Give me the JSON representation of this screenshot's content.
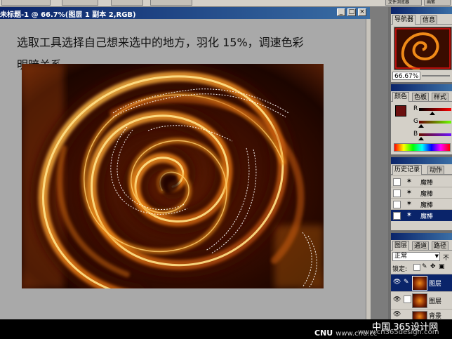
{
  "topbar": {
    "left_items": [
      "—",
      "█"
    ],
    "file_browser_label": "文件浏览器",
    "brushes_label": "画笔"
  },
  "document": {
    "title": "未标题-1 @ 66.7%(图层 1 副本 2,RGB)",
    "minimize": "_",
    "maximize": "□",
    "close": "×",
    "caption_line1": "选取工具选择自己想来选中的地方，羽化 15%，调速色彩",
    "caption_line2": "明暗关系。"
  },
  "navigator": {
    "tab_navigator": "导航器",
    "tab_info": "信息",
    "zoom_value": "66.67%"
  },
  "color": {
    "tab_color": "颜色",
    "tab_swatches": "色板",
    "tab_styles": "样式",
    "label_r": "R",
    "label_g": "G",
    "label_b": "B",
    "foreground_hex": "#6b1010",
    "background_hex": "#ffffff",
    "r_level": 0.42,
    "g_level": 0.06,
    "b_level": 0.06
  },
  "history": {
    "tab_history": "历史记录",
    "tab_actions": "动作",
    "items": [
      {
        "label": "魔棒",
        "selected": false
      },
      {
        "label": "魔棒",
        "selected": false
      },
      {
        "label": "魔棒",
        "selected": false
      },
      {
        "label": "魔棒",
        "selected": true
      }
    ]
  },
  "layers": {
    "tab_layers": "图层",
    "tab_channels": "通道",
    "tab_paths": "路径",
    "blend_mode": "正常",
    "opacity_prefix": "不",
    "lock_label": "锁定:",
    "rows": [
      {
        "label": "图层",
        "selected": true
      },
      {
        "label": "图层",
        "selected": false
      },
      {
        "label": "背景",
        "selected": false
      }
    ]
  },
  "watermark": {
    "site_cn": "中国 365设计网",
    "site_url": "www.cn365design.com",
    "cnu_logo": "CNU",
    "cnu_url": "www.cnu.cc"
  }
}
